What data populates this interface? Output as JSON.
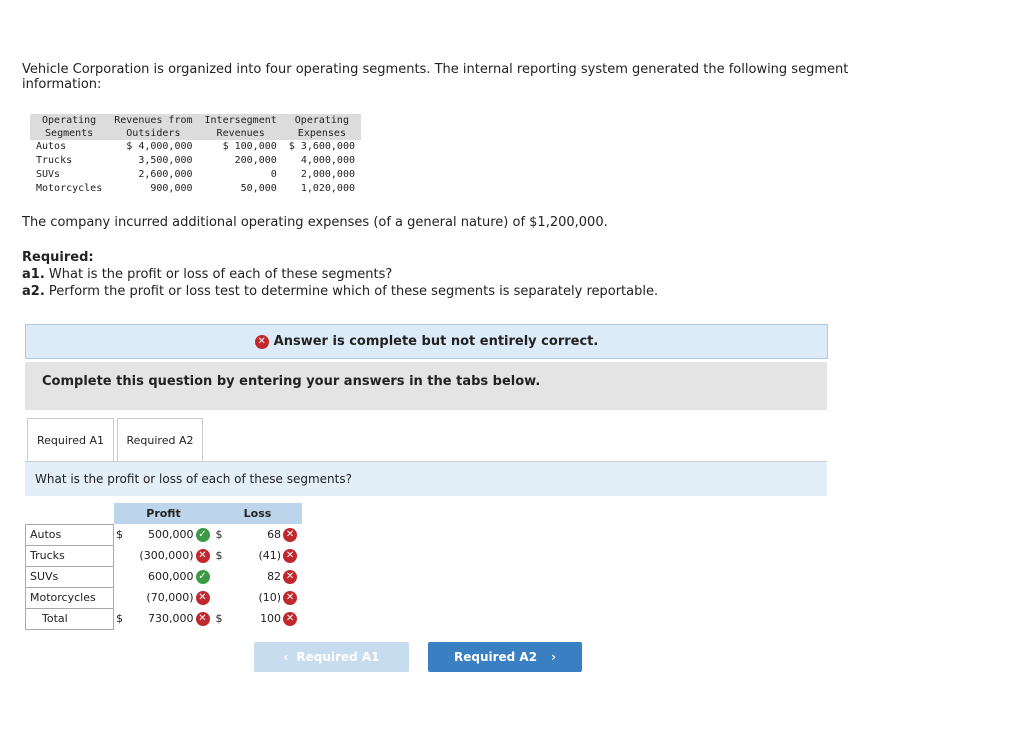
{
  "intro": "Vehicle Corporation is organized into four operating segments. The internal reporting system generated the following segment information:",
  "segment_table": {
    "headers": [
      [
        "Operating",
        "Segments"
      ],
      [
        "Revenues from",
        "Outsiders"
      ],
      [
        "Intersegment",
        "Revenues"
      ],
      [
        "Operating",
        "Expenses"
      ]
    ],
    "rows": [
      [
        "Autos",
        "$ 4,000,000",
        "$ 100,000",
        "$ 3,600,000"
      ],
      [
        "Trucks",
        "3,500,000",
        "200,000",
        "4,000,000"
      ],
      [
        "SUVs",
        "2,600,000",
        "0",
        "2,000,000"
      ],
      [
        "Motorcycles",
        "900,000",
        "50,000",
        "1,020,000"
      ]
    ]
  },
  "additional": "The company incurred additional operating expenses (of a general nature) of $1,200,000.",
  "required": {
    "heading": "Required:",
    "a1_label": "a1.",
    "a1_text": " What is the profit or loss of each of these segments?",
    "a2_label": "a2.",
    "a2_text": " Perform the profit or loss test to determine which of these segments is separately reportable."
  },
  "banner": "Answer is complete but not entirely correct.",
  "instruction": "Complete this question by entering your answers in the tabs below.",
  "tabs": [
    "Required A1",
    "Required A2"
  ],
  "question": "What is the profit or loss of each of these segments?",
  "answer_table": {
    "headers": [
      "Profit",
      "Loss"
    ],
    "rows": [
      {
        "label": "Autos",
        "profit_cur": "$",
        "profit": "500,000",
        "profit_status": "correct",
        "loss_cur": "$",
        "loss": "68",
        "loss_status": "incorrect"
      },
      {
        "label": "Trucks",
        "profit_cur": "",
        "profit": "(300,000)",
        "profit_status": "incorrect",
        "loss_cur": "$",
        "loss": "(41)",
        "loss_status": "incorrect"
      },
      {
        "label": "SUVs",
        "profit_cur": "",
        "profit": "600,000",
        "profit_status": "correct",
        "loss_cur": "",
        "loss": "82",
        "loss_status": "incorrect"
      },
      {
        "label": "Motorcycles",
        "profit_cur": "",
        "profit": "(70,000)",
        "profit_status": "incorrect",
        "loss_cur": "",
        "loss": "(10)",
        "loss_status": "incorrect"
      },
      {
        "label": "Total",
        "profit_cur": "$",
        "profit": "730,000",
        "profit_status": "incorrect",
        "loss_cur": "$",
        "loss": "100",
        "loss_status": "incorrect"
      }
    ]
  },
  "buttons": {
    "prev": "Required A1",
    "next": "Required A2"
  },
  "colors": {
    "incorrect": "#c0282d",
    "correct": "#3c9a45",
    "primary": "#3a7fc1"
  }
}
